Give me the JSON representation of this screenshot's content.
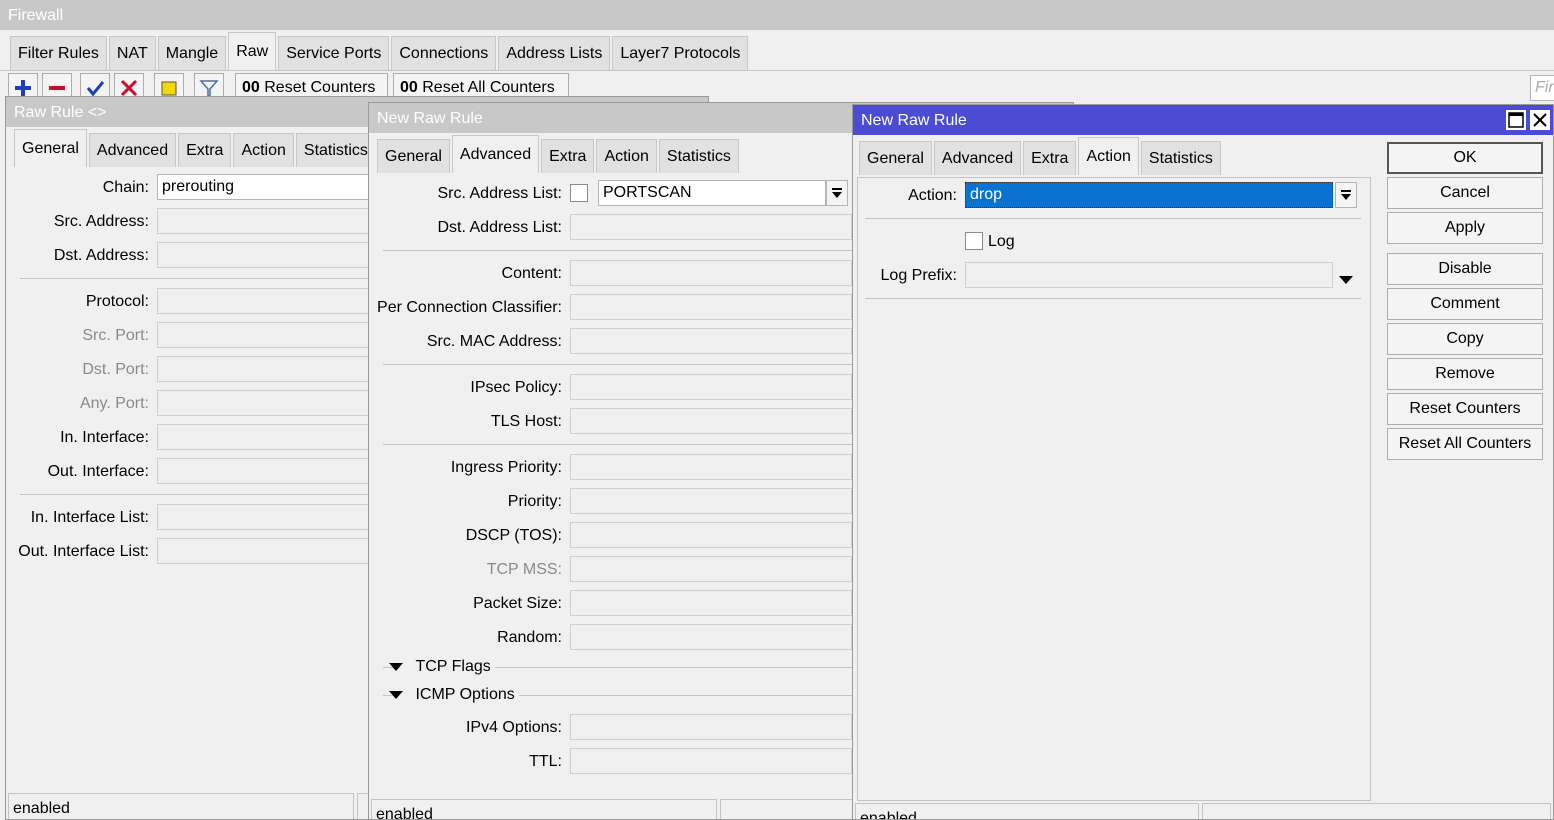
{
  "main": {
    "title": "Firewall",
    "tabs": [
      "Filter Rules",
      "NAT",
      "Mangle",
      "Raw",
      "Service Ports",
      "Connections",
      "Address Lists",
      "Layer7 Protocols"
    ],
    "toolbar": {
      "reset_counters": "Reset Counters",
      "reset_all_counters": "Reset All Counters",
      "counter_badge": "00",
      "find_placeholder": "Find"
    }
  },
  "win1": {
    "title": "Raw Rule <>",
    "tabs": [
      "General",
      "Advanced",
      "Extra",
      "Action",
      "Statistics"
    ],
    "labels": {
      "chain": "Chain:",
      "src_address": "Src. Address:",
      "dst_address": "Dst. Address:",
      "protocol": "Protocol:",
      "src_port": "Src. Port:",
      "dst_port": "Dst. Port:",
      "any_port": "Any. Port:",
      "in_interface": "In. Interface:",
      "out_interface": "Out. Interface:",
      "in_interface_list": "In. Interface List:",
      "out_interface_list": "Out. Interface List:"
    },
    "values": {
      "chain": "prerouting"
    },
    "status": "enabled"
  },
  "win2": {
    "title": "New Raw Rule",
    "tabs": [
      "General",
      "Advanced",
      "Extra",
      "Action",
      "Statistics"
    ],
    "labels": {
      "src_address_list": "Src. Address List:",
      "dst_address_list": "Dst. Address List:",
      "content": "Content:",
      "per_connection_classifier": "Per Connection Classifier:",
      "src_mac_address": "Src. MAC Address:",
      "ipsec_policy": "IPsec Policy:",
      "tls_host": "TLS Host:",
      "ingress_priority": "Ingress Priority:",
      "priority": "Priority:",
      "dscp": "DSCP (TOS):",
      "tcp_mss": "TCP MSS:",
      "packet_size": "Packet Size:",
      "random": "Random:",
      "tcp_flags": "TCP Flags",
      "icmp_options": "ICMP Options",
      "ipv4_options": "IPv4 Options:",
      "ttl": "TTL:"
    },
    "values": {
      "src_address_list": "PORTSCAN"
    },
    "status": "enabled"
  },
  "win3": {
    "title": "New Raw Rule",
    "tabs": [
      "General",
      "Advanced",
      "Extra",
      "Action",
      "Statistics"
    ],
    "labels": {
      "action": "Action:",
      "log": "Log",
      "log_prefix": "Log Prefix:"
    },
    "values": {
      "action": "drop"
    },
    "buttons": {
      "ok": "OK",
      "cancel": "Cancel",
      "apply": "Apply",
      "disable": "Disable",
      "comment": "Comment",
      "copy": "Copy",
      "remove": "Remove",
      "reset_counters": "Reset Counters",
      "reset_all_counters": "Reset All Counters"
    },
    "status": "enabled"
  },
  "colors": {
    "active_title": "#4b4bd3",
    "inactive_title": "#c8c8c8",
    "selection": "#0a73d1"
  }
}
